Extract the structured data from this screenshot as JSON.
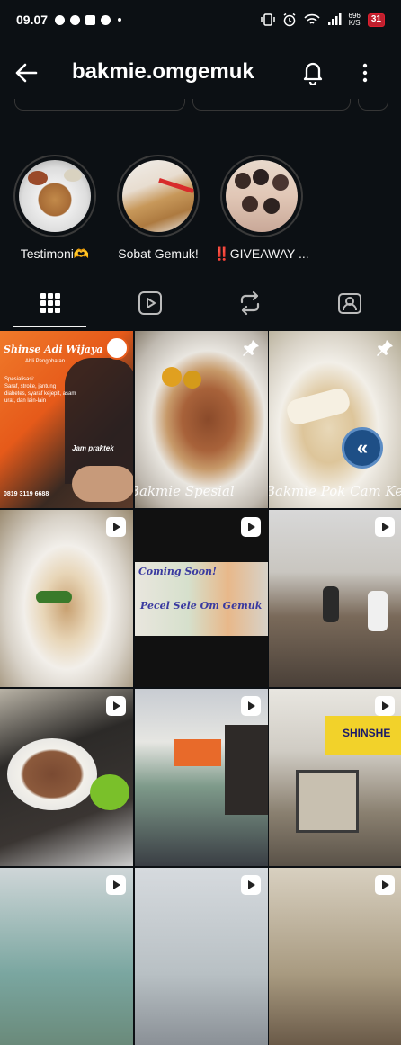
{
  "status_bar": {
    "time": "09.07",
    "speed_top": "696",
    "speed_bottom": "K/S",
    "battery": "31"
  },
  "header": {
    "username": "bakmie.omgemuk",
    "icons": [
      "back-arrow-icon",
      "bell-icon",
      "more-vertical-icon"
    ]
  },
  "highlights": [
    {
      "label": "Testimoni🫶"
    },
    {
      "label": "Sobat Gemuk!"
    },
    {
      "label": "‼️GIVEAWAY ..."
    }
  ],
  "tabs": [
    "grid-icon",
    "reels-icon",
    "reposts-icon",
    "tagged-icon"
  ],
  "posts": [
    {
      "type": "pinned",
      "title": "Shinse Adi Wijaya",
      "subtitle": "Ahli Pengobatan",
      "lines": [
        "Spesialisasi:",
        "Saraf, stroke, jantung",
        "diabetes, syaraf kejepit, asam",
        "urat, dan lain-lain",
        "Jam praktek"
      ],
      "phone": "0819 3119 6688"
    },
    {
      "type": "pinned",
      "caption": "Bakmie Spesial"
    },
    {
      "type": "pinned",
      "caption": "Bakmie Pok Cam Keo"
    },
    {
      "type": "reel"
    },
    {
      "type": "reel",
      "caption_top": "Coming Soon!",
      "caption_bottom": "Pecel Sele Om Gemuk"
    },
    {
      "type": "reel"
    },
    {
      "type": "reel"
    },
    {
      "type": "reel"
    },
    {
      "type": "reel",
      "sign": "SHINSHE"
    },
    {
      "type": "reel"
    },
    {
      "type": "reel"
    },
    {
      "type": "reel"
    }
  ],
  "colors": {
    "background": "#0c1014",
    "text": "#f5f5f5",
    "fab": "#1e4f86"
  }
}
